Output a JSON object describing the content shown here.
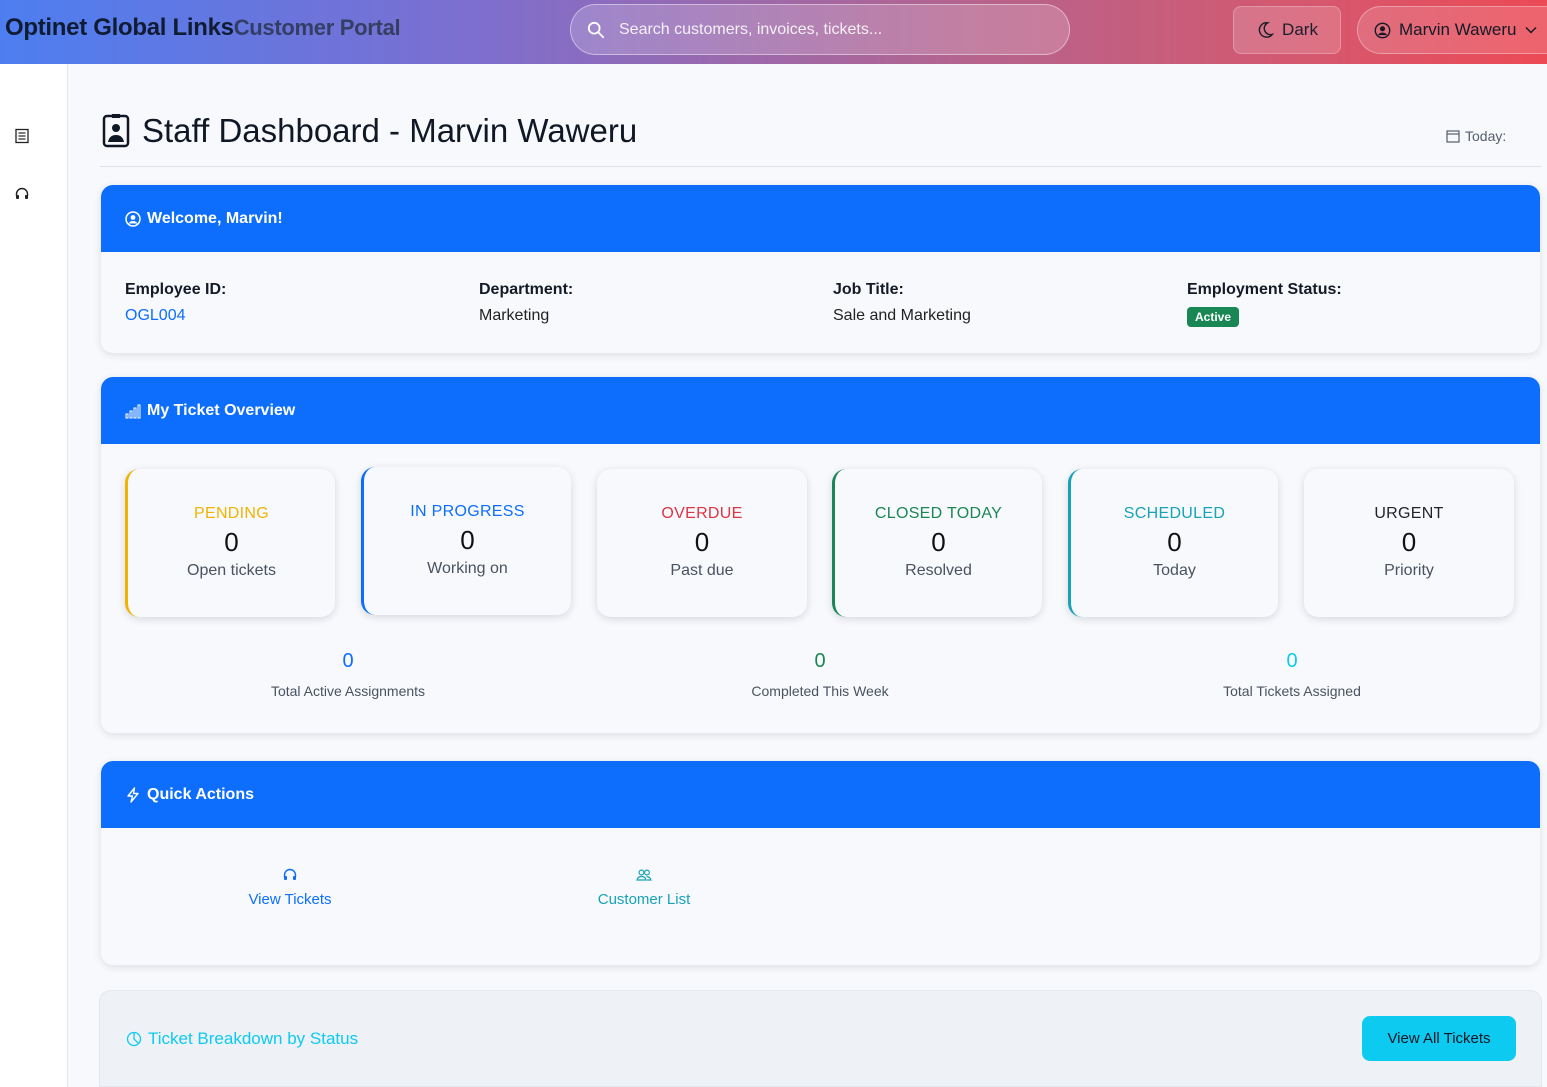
{
  "header": {
    "brand": "Optinet Global Links",
    "brand_sub": "Customer Portal",
    "search_placeholder": "Search customers, invoices, tickets...",
    "dark_label": "Dark",
    "user_name": "Marvin Waweru"
  },
  "sidebar": {
    "items": [
      {
        "icon": "document-icon"
      },
      {
        "icon": "headset-icon"
      }
    ]
  },
  "page": {
    "title": "Staff Dashboard - Marvin Waweru",
    "today_label": "Today:"
  },
  "welcome": {
    "title": "Welcome, Marvin!",
    "fields": [
      {
        "label": "Employee ID:",
        "value": "OGL004"
      },
      {
        "label": "Department:",
        "value": "Marketing"
      },
      {
        "label": "Job Title:",
        "value": "Sale and Marketing"
      },
      {
        "label": "Employment Status:",
        "value": "Active"
      }
    ]
  },
  "overview": {
    "title": "My Ticket Overview",
    "stats": [
      {
        "label": "PENDING",
        "value": "0",
        "sub": "Open tickets",
        "color": "#f0b400"
      },
      {
        "label": "IN PROGRESS",
        "value": "0",
        "sub": "Working on",
        "color": "#0d6efd"
      },
      {
        "label": "OVERDUE",
        "value": "0",
        "sub": "Past due",
        "color": "#dc3545"
      },
      {
        "label": "CLOSED TODAY",
        "value": "0",
        "sub": "Resolved",
        "color": "#198754"
      },
      {
        "label": "SCHEDULED",
        "value": "0",
        "sub": "Today",
        "color": "#17a2b8"
      },
      {
        "label": "URGENT",
        "value": "0",
        "sub": "Priority",
        "color": "#212529"
      }
    ],
    "totals": [
      {
        "value": "0",
        "label": "Total Active Assignments",
        "color": "#0d6efd"
      },
      {
        "value": "0",
        "label": "Completed This Week",
        "color": "#198754"
      },
      {
        "value": "0",
        "label": "Total Tickets Assigned",
        "color": "#0dcaf0"
      }
    ]
  },
  "quick_actions": {
    "title": "Quick Actions",
    "items": [
      {
        "label": "View Tickets",
        "color": "#0d6efd"
      },
      {
        "label": "Customer List",
        "color": "#17a2b8"
      }
    ]
  },
  "breakdown": {
    "title": "Ticket Breakdown by Status",
    "button": "View All Tickets"
  }
}
